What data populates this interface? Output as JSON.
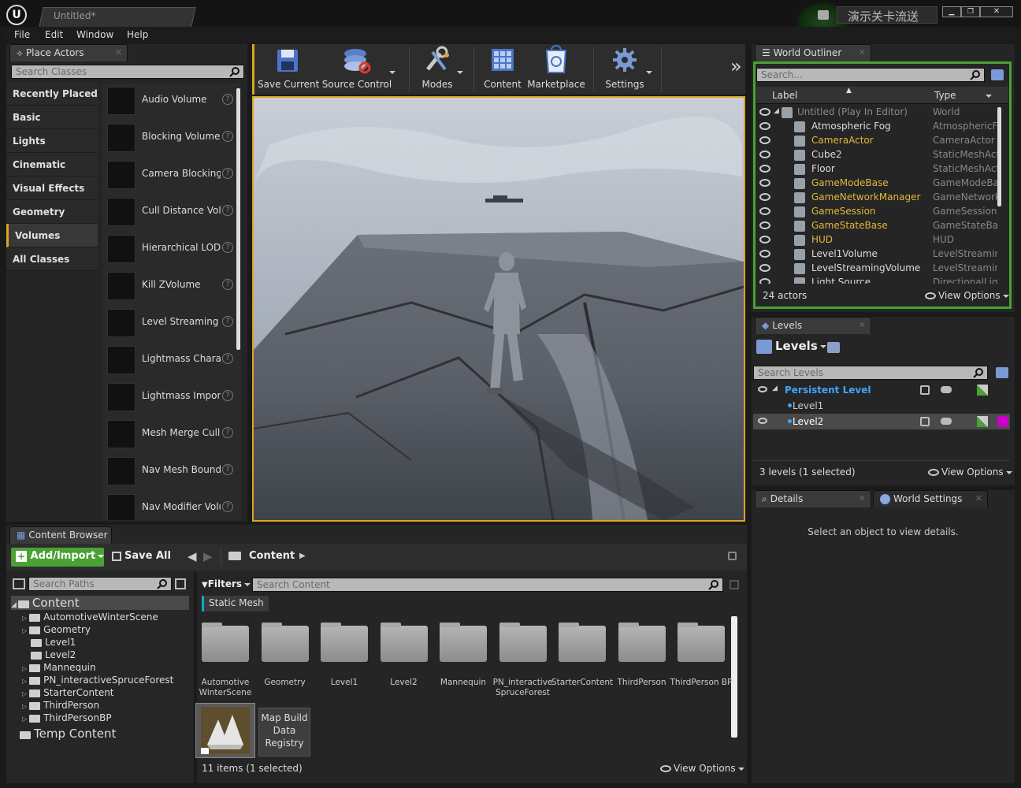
{
  "window": {
    "title": "Untitled*",
    "right_label": "演示关卡流送",
    "controls": [
      "▁",
      "❐",
      "✕"
    ]
  },
  "menu": [
    "File",
    "Edit",
    "Window",
    "Help"
  ],
  "place_actors": {
    "tab": "Place Actors",
    "search_placeholder": "Search Classes",
    "categories": [
      "Recently Placed",
      "Basic",
      "Lights",
      "Cinematic",
      "Visual Effects",
      "Geometry",
      "Volumes",
      "All Classes"
    ],
    "selected_category": "Volumes",
    "items": [
      "Audio Volume",
      "Blocking Volume",
      "Camera Blocking",
      "Cull Distance Vol",
      "Hierarchical LODVol",
      "Kill ZVolume",
      "Level Streaming",
      "Lightmass Chara",
      "Lightmass Impor",
      "Mesh Merge Culling",
      "Nav Mesh Bound",
      "Nav Modifier Volu"
    ],
    "help_glyph": "?"
  },
  "toolbar": {
    "buttons": [
      "Save Current",
      "Source Control",
      "Modes",
      "Content",
      "Marketplace",
      "Settings"
    ],
    "overflow": "»"
  },
  "world_outliner": {
    "tab": "World Outliner",
    "search_placeholder": "Search...",
    "col_label": "Label",
    "col_type": "Type",
    "rows": [
      {
        "name": "Untitled (Play In Editor)",
        "type": "World",
        "color": "#8a8a8a"
      },
      {
        "name": "Atmospheric Fog",
        "type": "AtmosphericFo",
        "color": "#dddddd"
      },
      {
        "name": "CameraActor",
        "type": "CameraActor",
        "color": "#e2b83c"
      },
      {
        "name": "Cube2",
        "type": "StaticMeshActo",
        "color": "#dddddd"
      },
      {
        "name": "Floor",
        "type": "StaticMeshActo",
        "color": "#dddddd"
      },
      {
        "name": "GameModeBase",
        "type": "GameModeBas",
        "color": "#e2b83c"
      },
      {
        "name": "GameNetworkManager",
        "type": "GameNetworkM",
        "color": "#e2b83c"
      },
      {
        "name": "GameSession",
        "type": "GameSession",
        "color": "#e2b83c"
      },
      {
        "name": "GameStateBase",
        "type": "GameStateBas",
        "color": "#e2b83c"
      },
      {
        "name": "HUD",
        "type": "HUD",
        "color": "#e2b83c"
      },
      {
        "name": "Level1Volume",
        "type": "LevelStreaming",
        "color": "#dddddd"
      },
      {
        "name": "LevelStreamingVolume",
        "type": "LevelStreaming",
        "color": "#dddddd"
      },
      {
        "name": "Light Source",
        "type": "DirectionalLigh",
        "color": "#dddddd"
      }
    ],
    "footer_count": "24 actors",
    "view_options": "View Options"
  },
  "levels": {
    "tab": "Levels",
    "header": "Levels",
    "search_placeholder": "Search Levels",
    "rows": [
      {
        "name": "Persistent Level",
        "color": "#3fa6ff"
      },
      {
        "name": "Level1",
        "color": "#cccccc"
      },
      {
        "name": "Level2",
        "color": "#ffffff"
      }
    ],
    "footer": "3 levels (1 selected)",
    "view_options": "View Options",
    "level2_color": "#c800c8"
  },
  "details": {
    "tab": "Details",
    "tab2": "World Settings",
    "empty_message": "Select an object to view details."
  },
  "content_browser": {
    "tab": "Content Browser",
    "add_import": "Add/Import",
    "save_all": "Save All",
    "breadcrumb": "Content",
    "search_paths_placeholder": "Search Paths",
    "filters": "Filters",
    "search_content_placeholder": "Search Content",
    "filter_chip": "Static Mesh",
    "tree": [
      {
        "label": "Content",
        "level": 0,
        "expanded": true
      },
      {
        "label": "AutomotiveWinterScene",
        "level": 1
      },
      {
        "label": "Geometry",
        "level": 1
      },
      {
        "label": "Level1",
        "level": 1
      },
      {
        "label": "Level2",
        "level": 1
      },
      {
        "label": "Mannequin",
        "level": 1
      },
      {
        "label": "PN_interactiveSpruceForest",
        "level": 1
      },
      {
        "label": "StarterContent",
        "level": 1
      },
      {
        "label": "ThirdPerson",
        "level": 1
      },
      {
        "label": "ThirdPersonBP",
        "level": 1
      },
      {
        "label": "Temp Content",
        "level": 0
      }
    ],
    "folders": [
      "Automotive WinterScene",
      "Geometry",
      "Level1",
      "Level2",
      "Mannequin",
      "PN_interactive SpruceForest",
      "StarterContent",
      "ThirdPerson",
      "ThirdPerson BP"
    ],
    "assets": [
      "",
      "Map Build Data Registry"
    ],
    "footer": "11 items (1 selected)",
    "view_options": "View Options"
  },
  "colors": {
    "accent_green": "#4aa135",
    "highlight_orange": "#d9a520",
    "select_blue": "#3fa6ff"
  }
}
